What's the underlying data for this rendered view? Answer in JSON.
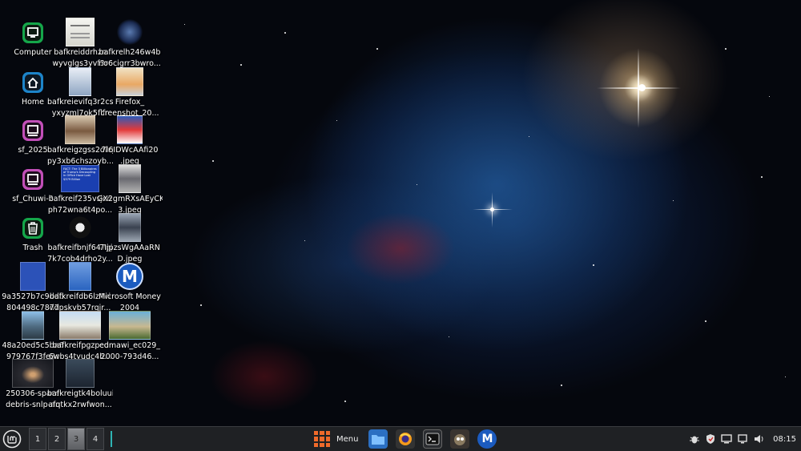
{
  "desktop": {
    "icons": [
      {
        "label1": "Computer",
        "label2": ""
      },
      {
        "label1": "bafkreiddrhzo",
        "label2": "wyvglgs3yvf3r"
      },
      {
        "label1": "bafkrelh246w4b",
        "label2": "no6cigrr3bwro..."
      },
      {
        "label1": "Home",
        "label2": ""
      },
      {
        "label1": "bafkreievifq3r2cst",
        "label2": "yxyzml7ok5flfr"
      },
      {
        "label1": "Firefox_",
        "label2": "creenshot_20..."
      },
      {
        "label1": "sf_2025",
        "label2": ""
      },
      {
        "label1": "bafkreigzgss2dfcp6",
        "label2": "py3xb6chszoyb..."
      },
      {
        "label1": "7I6IDWcAAfi20",
        "label2": ".jpeg"
      },
      {
        "label1": "sf_Chuwi-2",
        "label2": ""
      },
      {
        "label1": "bafkreif235vsjcn",
        "label2": "ph72wna6t4po..."
      },
      {
        "label1": "GX2gmRXsAEyCK",
        "label2": "3.jpeg"
      },
      {
        "label1": "Trash",
        "label2": ""
      },
      {
        "label1": "bafkreifbnjf647gj",
        "label2": "7k7cob4drho2y..."
      },
      {
        "label1": "7IjpzsWgAAaRN",
        "label2": "D.jpeg"
      },
      {
        "label1": "9a3527b7c9ddb",
        "label2": "804498c78d7"
      },
      {
        "label1": "bafkreifdb6lz4vi",
        "label2": "7dpskvb57rqjr..."
      },
      {
        "label1": "Microsoft Money",
        "label2": "2004"
      },
      {
        "label1": "48a20ed5c5ba6",
        "label2": "979767f3fe8c"
      },
      {
        "label1": "bafkreifpgzpcc",
        "label2": "6wbs4tyudc4b..."
      },
      {
        "label1": "edmawi_ec029_",
        "label2": "2000-793d46..."
      },
      {
        "label1": "250306-space",
        "label2": "debris-snlp-an"
      },
      {
        "label1": "bafkreigtk4boluui",
        "label2": "afqtkx2rwfwon..."
      }
    ],
    "thumb_text": "FACT: The 3 Billionaires of Trump's Decoupling in Office Have Lost $379 Billion",
    "icon_letter": "M"
  },
  "panel": {
    "menu_label": "Menu",
    "workspaces": [
      "1",
      "2",
      "3",
      "4"
    ],
    "clock": "08:15",
    "accent_color": "#f06a2a",
    "separator_color": "#2fb3b3"
  }
}
